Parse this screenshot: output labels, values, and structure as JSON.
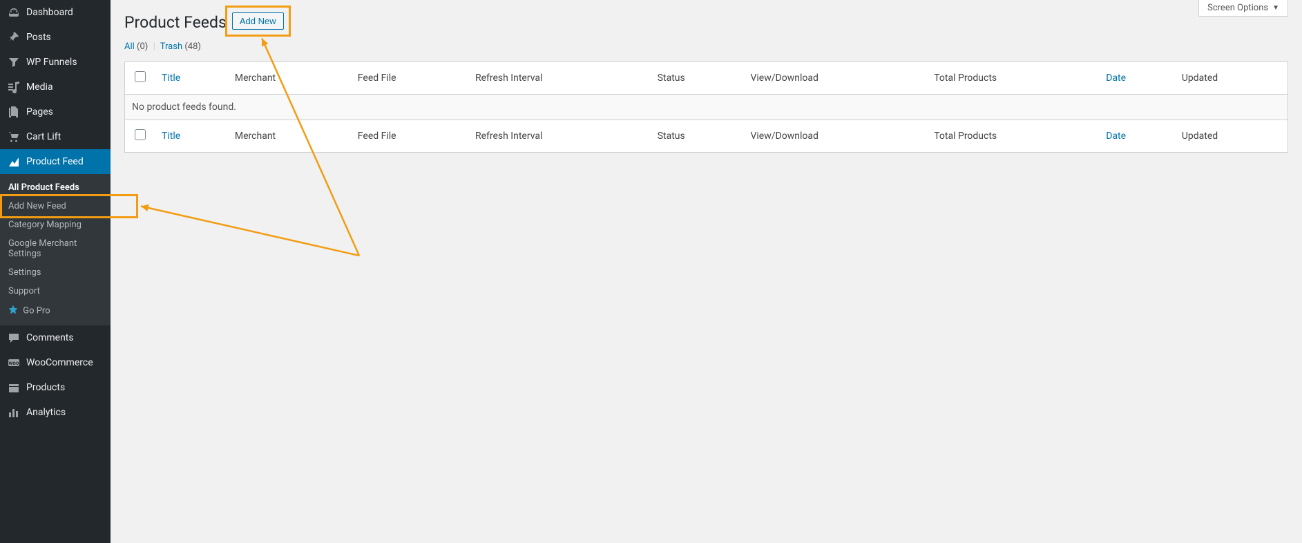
{
  "sidebar": {
    "items": [
      {
        "label": "Dashboard",
        "icon": "dashboard"
      },
      {
        "label": "Posts",
        "icon": "pin"
      },
      {
        "label": "WP Funnels",
        "icon": "funnel"
      },
      {
        "label": "Media",
        "icon": "media"
      },
      {
        "label": "Pages",
        "icon": "pages"
      },
      {
        "label": "Cart Lift",
        "icon": "cart"
      },
      {
        "label": "Product Feed",
        "icon": "chart",
        "active": true
      },
      {
        "label": "Comments",
        "icon": "comment"
      },
      {
        "label": "WooCommerce",
        "icon": "woo"
      },
      {
        "label": "Products",
        "icon": "products"
      },
      {
        "label": "Analytics",
        "icon": "analytics"
      }
    ],
    "submenu": [
      {
        "label": "All Product Feeds",
        "current": true
      },
      {
        "label": "Add New Feed"
      },
      {
        "label": "Category Mapping"
      },
      {
        "label": "Google Merchant Settings"
      },
      {
        "label": "Settings"
      },
      {
        "label": "Support"
      },
      {
        "label": "Go Pro",
        "pro": true
      }
    ]
  },
  "screen_options_label": "Screen Options",
  "page_title": "Product Feeds",
  "add_new_label": "Add New",
  "filters": {
    "all_label": "All",
    "all_count": "(0)",
    "trash_label": "Trash",
    "trash_count": "(48)"
  },
  "table": {
    "columns": [
      "Title",
      "Merchant",
      "Feed File",
      "Refresh Interval",
      "Status",
      "View/Download",
      "Total Products",
      "Date",
      "Updated"
    ],
    "sortable_columns": [
      "Title",
      "Date"
    ],
    "empty_message": "No product feeds found."
  }
}
